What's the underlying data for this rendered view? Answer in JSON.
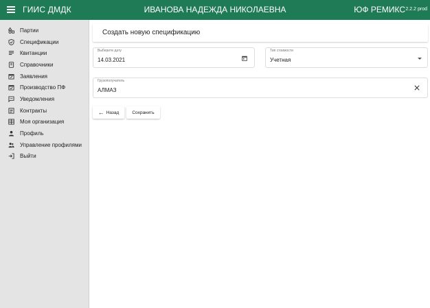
{
  "header": {
    "app_title": "ГИИС ДМДК",
    "user_name": "ИВАНОВА НАДЕЖДА НИКОЛАЕВНА",
    "org_name": "ЮФ РЕМИКС",
    "version": "2.2.2 prod"
  },
  "sidebar": {
    "items": [
      {
        "label": "Партии",
        "icon": "shapes-icon"
      },
      {
        "label": "Спецификации",
        "icon": "shield-check-icon"
      },
      {
        "label": "Квитанции",
        "icon": "receipt-list-icon"
      },
      {
        "label": "Справочники",
        "icon": "book-icon"
      },
      {
        "label": "Заявления",
        "icon": "calendar-edit-icon"
      },
      {
        "label": "Производство ПФ",
        "icon": "calendar-check-icon"
      },
      {
        "label": "Уведомления",
        "icon": "chat-dots-icon"
      },
      {
        "label": "Контракты",
        "icon": "document-lines-icon"
      },
      {
        "label": "Моя организация",
        "icon": "building-icon"
      },
      {
        "label": "Профиль",
        "icon": "person-icon"
      },
      {
        "label": "Управление профилями",
        "icon": "people-icon"
      },
      {
        "label": "Выйти",
        "icon": "logout-icon"
      }
    ]
  },
  "main": {
    "page_title": "Создать новую спецификацию",
    "date_field": {
      "label": "Выберите дату",
      "value": "14.03.2021"
    },
    "cost_type_field": {
      "label": "Тип стоимости",
      "value": "Учетная"
    },
    "consignee_field": {
      "label": "Грузополучатель",
      "value": "АЛМАЗ"
    },
    "back_button": "Назад",
    "save_button": "Сохранить"
  }
}
